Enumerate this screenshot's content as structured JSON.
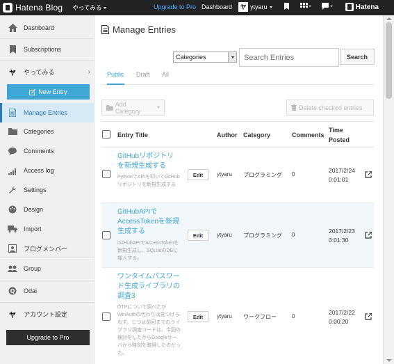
{
  "topbar": {
    "brand": "Hatena Blog",
    "blog_name": "やってみる",
    "upgrade": "Upgrade to Pro",
    "dashboard": "Dashboard",
    "username": "ytyaru",
    "hatena": "Hatena"
  },
  "sidebar": {
    "dashboard": "Dashboard",
    "subscriptions": "Subscriptions",
    "blog": "やってみる",
    "new_entry": "New Entry",
    "manage_entries": "Manage Entries",
    "categories": "Categories",
    "comments": "Comments",
    "access_log": "Access log",
    "settings": "Settings",
    "design": "Design",
    "import": "Import",
    "blog_members": "ブログメンバー",
    "group": "Group",
    "odai": "Odai",
    "account": "アカウント設定",
    "upgrade": "Upgrade to Pro"
  },
  "main": {
    "title": "Manage Entries",
    "category_select": "Categories",
    "search_placeholder": "Search Entries",
    "search_button": "Search",
    "tabs": [
      "Public",
      "Draft",
      "All"
    ],
    "add_category": "Add Category",
    "delete_checked": "Delete checked entries",
    "headers": {
      "title": "Entry Title",
      "author": "Author",
      "category": "Category",
      "comments": "Comments",
      "time_posted_1": "Time",
      "time_posted_2": "Posted"
    },
    "edit_label": "Edit",
    "entries": [
      {
        "title": "GitHubリポジトリを新規生成する",
        "excerpt": "PythonでAPIを叩いてGitHubリポジトリを新規生成する",
        "author": "ytyaru",
        "category": "プログラミング",
        "comments": "0",
        "date": "2017/2/24",
        "time": "0:01:01"
      },
      {
        "title": "GitHubAPIでAccessTokenを新規生成する",
        "excerpt": "GitHubAPIでAccessTokenを新規生成し、SQLiteのDBに挿入する。",
        "author": "ytyaru",
        "category": "プログラミング",
        "comments": "0",
        "date": "2017/2/23",
        "time": "0:01:30"
      },
      {
        "title": "ワンタイムパスワード生成ライブラリの調査3",
        "excerpt": "OTPについて調べたがWinAuthの代わりは見つけられず。じつは前回までのライブラリ調査コードは、今回の検討をしたからGoogleサーバから時刻を取得したのだった。",
        "author": "ytyaru",
        "category": "ワークフロー",
        "comments": "0",
        "date": "2017/2/22",
        "time": "0:00:20"
      }
    ]
  }
}
